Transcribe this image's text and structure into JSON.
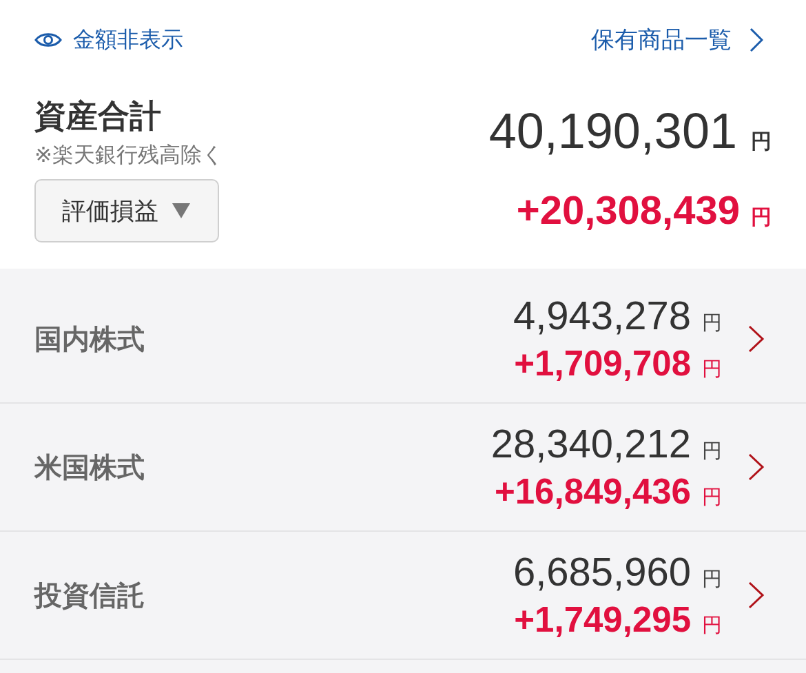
{
  "header": {
    "hide_amounts_link": {
      "label": "金額非表示"
    },
    "holdings_link": {
      "label": "保有商品一覧"
    }
  },
  "summary": {
    "title": "資産合計",
    "note": "※楽天銀行残高除く",
    "total": "40,190,301",
    "total_unit": "円",
    "dropdown": {
      "label": "評価損益"
    },
    "gain": "+20,308,439",
    "gain_unit": "円"
  },
  "categories": [
    {
      "name": "国内株式",
      "value": "4,943,278",
      "value_unit": "円",
      "gain": "+1,709,708",
      "gain_unit": "円"
    },
    {
      "name": "米国株式",
      "value": "28,340,212",
      "value_unit": "円",
      "gain": "+16,849,436",
      "gain_unit": "円"
    },
    {
      "name": "投資信託",
      "value": "6,685,960",
      "value_unit": "円",
      "gain": "+1,749,295",
      "gain_unit": "円"
    }
  ]
}
